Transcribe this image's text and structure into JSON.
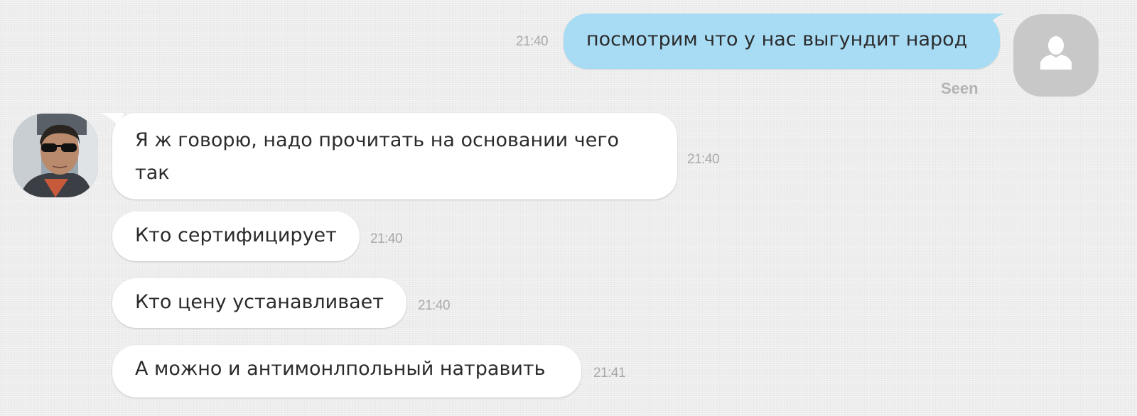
{
  "outgoing": [
    {
      "text": "посмотрим что у нас выгундит народ",
      "time": "21:40",
      "status": "Seen"
    }
  ],
  "incoming": [
    {
      "text": "Я ж говорю, надо прочитать на основании чего так",
      "time": "21:40"
    },
    {
      "text": "Кто сертифицирует",
      "time": "21:40"
    },
    {
      "text": "Кто цену устанавливает",
      "time": "21:40"
    },
    {
      "text": "А можно и антимонлпольный натравить",
      "time": "21:41"
    }
  ],
  "icons": {
    "self_avatar": "user-silhouette-icon",
    "contact_avatar": "contact-photo"
  },
  "colors": {
    "outgoing_bubble": "#a8dcf5",
    "incoming_bubble": "#ffffff",
    "background": "#ededed",
    "timestamp": "#a9a9a9"
  }
}
